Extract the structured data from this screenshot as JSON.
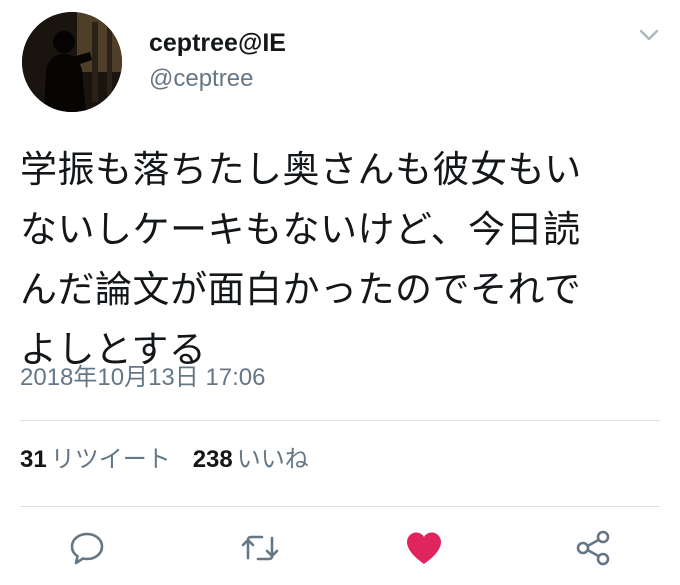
{
  "user": {
    "display_name": "ceptree@IE",
    "handle": "@ceptree"
  },
  "tweet": {
    "text": "学振も落ちたし奥さんも彼女もい\nないしケーキもないけど、今日読\nんだ論文が面白かったのでそれで\nよしとする",
    "timestamp": "2018年10月13日 17:06"
  },
  "stats": {
    "retweet_count": "31",
    "retweet_label": "リツイート",
    "like_count": "238",
    "like_label": "いいね"
  },
  "actions": {
    "reply_icon": "speech-bubble",
    "retweet_icon": "retweet-arrows",
    "like_icon": "heart-filled",
    "share_icon": "share-nodes",
    "like_color": "#e0245e",
    "icon_color": "#657786"
  },
  "colors": {
    "text": "#14171a",
    "secondary": "#657786",
    "divider": "#d8dee3"
  }
}
